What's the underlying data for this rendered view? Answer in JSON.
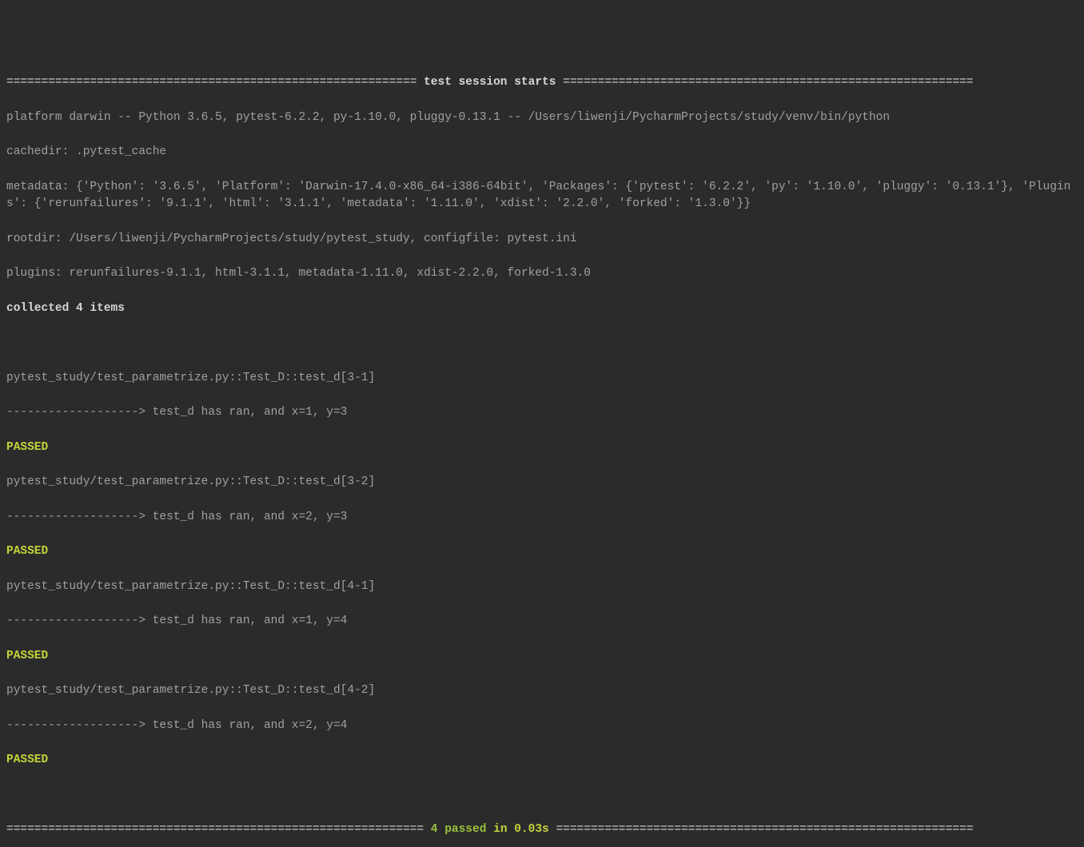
{
  "header": {
    "rule_left": "=========================================================== ",
    "title": "test session starts",
    "rule_right": " ===========================================================",
    "platform": "platform darwin -- Python 3.6.5, pytest-6.2.2, py-1.10.0, pluggy-0.13.1 -- /Users/liwenji/PycharmProjects/study/venv/bin/python",
    "cachedir": "cachedir: .pytest_cache",
    "metadata": "metadata: {'Python': '3.6.5', 'Platform': 'Darwin-17.4.0-x86_64-i386-64bit', 'Packages': {'pytest': '6.2.2', 'py': '1.10.0', 'pluggy': '0.13.1'}, 'Plugins': {'rerunfailures': '9.1.1', 'html': '3.1.1', 'metadata': '1.11.0', 'xdist': '2.2.0', 'forked': '1.3.0'}}",
    "rootdir": "rootdir: /Users/liwenji/PycharmProjects/study/pytest_study, configfile: pytest.ini",
    "plugins": "plugins: rerunfailures-9.1.1, html-3.1.1, metadata-1.11.0, xdist-2.2.0, forked-1.3.0",
    "collected": "collected 4 items"
  },
  "tests": [
    {
      "id": "pytest_study/test_parametrize.py::Test_D::test_d[3-1] ",
      "log": "-------------------> test_d has ran, and x=1, y=3",
      "status": "PASSED"
    },
    {
      "id": "pytest_study/test_parametrize.py::Test_D::test_d[3-2] ",
      "log": "-------------------> test_d has ran, and x=2, y=3",
      "status": "PASSED"
    },
    {
      "id": "pytest_study/test_parametrize.py::Test_D::test_d[4-1] ",
      "log": "-------------------> test_d has ran, and x=1, y=4",
      "status": "PASSED"
    },
    {
      "id": "pytest_study/test_parametrize.py::Test_D::test_d[4-2] ",
      "log": "-------------------> test_d has ran, and x=2, y=4",
      "status": "PASSED"
    }
  ],
  "footer": {
    "rule_left": "============================================================ ",
    "summary_pass": "4 passed",
    "summary_time": " in 0.03s",
    "rule_right": " ============================================================"
  }
}
